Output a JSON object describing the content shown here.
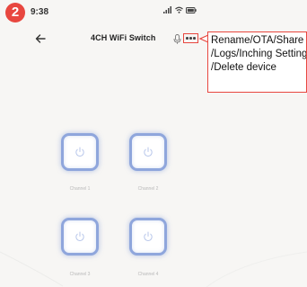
{
  "step_number": "2",
  "status_bar": {
    "time": "9:38"
  },
  "header": {
    "title": "4CH WiFi Switch",
    "back_icon": "arrow-left-icon",
    "mic_icon": "microphone-icon",
    "more_icon": "more-dots-icon"
  },
  "callout": {
    "lines": [
      "Rename/OTA/Share",
      "/Logs/Inching Settings",
      "/Delete device"
    ],
    "color": "#e8473f"
  },
  "switches": [
    {
      "label": "Channel 1",
      "icon": "power-icon"
    },
    {
      "label": "Channel 2",
      "icon": "power-icon"
    },
    {
      "label": "Channel 3",
      "icon": "power-icon"
    },
    {
      "label": "Channel 4",
      "icon": "power-icon"
    }
  ],
  "colors": {
    "switch_border": "#8fa6dc",
    "accent": "#e8473f"
  }
}
